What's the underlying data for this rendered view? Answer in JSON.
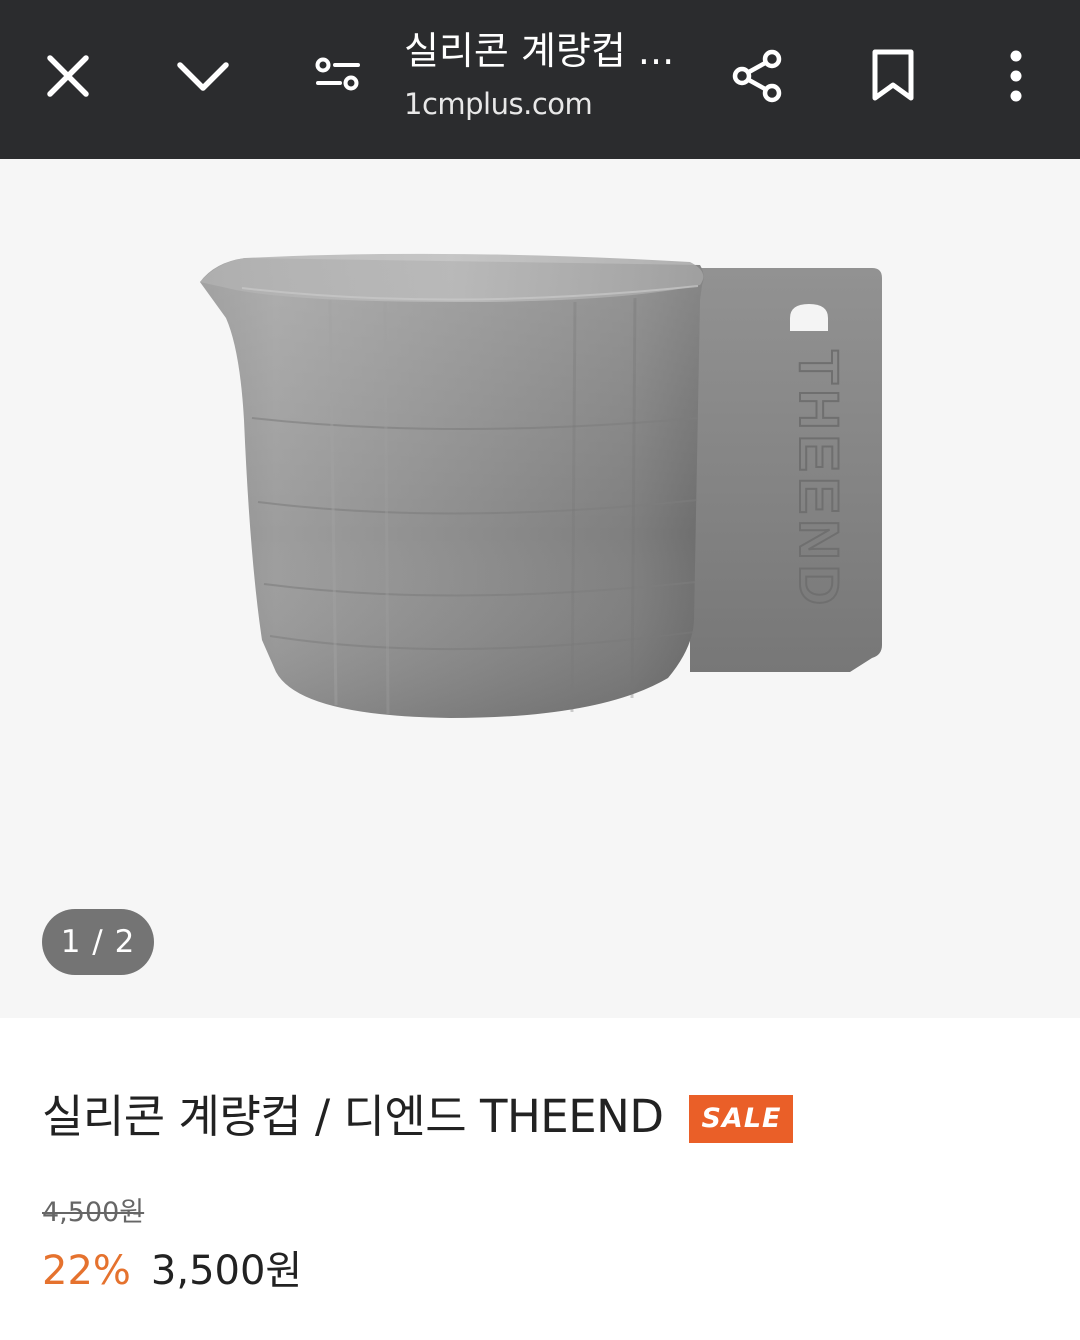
{
  "browser": {
    "title": "실리콘 계량컵 ...",
    "url": "1cmplus.com",
    "icons": [
      "close-icon",
      "chevron-down-icon",
      "filter-icon",
      "share-icon",
      "bookmark-icon",
      "more-vert-icon"
    ]
  },
  "gallery": {
    "counter": "1 / 2",
    "current_index": 1,
    "total": 2,
    "image_brand_text": "THEEND"
  },
  "product": {
    "name": "실리콘 계량컵 / 디엔드 THEEND",
    "badge": "SALE",
    "original_price": "4,500원",
    "discount": "22%",
    "price": "3,500원"
  },
  "colors": {
    "topbar": "#2b2c2e",
    "sale_badge": "#ea5f28",
    "discount_text": "#e5722e",
    "gallery_bg": "#f6f6f6"
  }
}
